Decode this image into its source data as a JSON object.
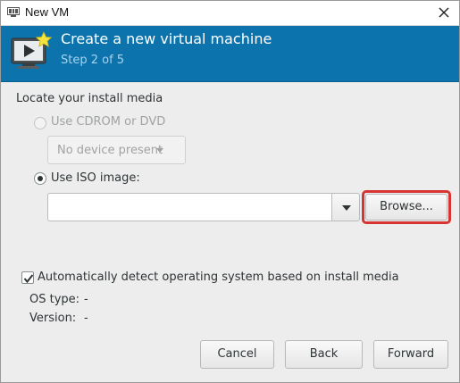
{
  "window": {
    "title": "New VM"
  },
  "header": {
    "title": "Create a new virtual machine",
    "step": "Step 2 of 5",
    "icon": "virtual-machine-new-icon",
    "background_color": "#0c73ad"
  },
  "media": {
    "section_label": "Locate your install media",
    "cdrom": {
      "label": "Use CDROM or DVD",
      "selected": false,
      "enabled": false,
      "device_value": "No device present"
    },
    "iso": {
      "label": "Use ISO image:",
      "selected": true,
      "path_value": "",
      "browse_label": "Browse..."
    }
  },
  "os_detect": {
    "checkbox_label": "Automatically detect operating system based on install media",
    "checked": true,
    "os_type_label": "OS type:",
    "os_type_value": "-",
    "version_label": "Version:",
    "version_value": "-"
  },
  "actions": {
    "cancel_label": "Cancel",
    "back_label": "Back",
    "forward_label": "Forward"
  },
  "highlight_color": "#d83434"
}
